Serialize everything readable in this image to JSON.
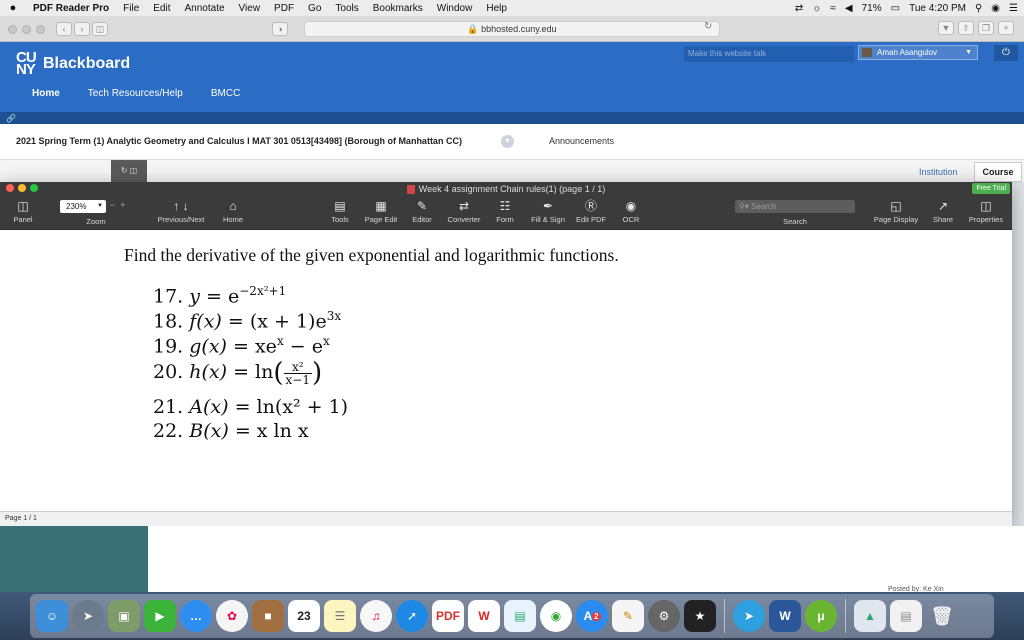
{
  "menubar": {
    "apple": "",
    "items": [
      "PDF Reader Pro",
      "File",
      "Edit",
      "Annotate",
      "View",
      "PDF",
      "Go",
      "Tools",
      "Bookmarks",
      "Window",
      "Help"
    ],
    "battery": "71%",
    "clock": "Tue 4:20 PM"
  },
  "browser": {
    "url": "bbhosted.cuny.edu"
  },
  "blackboard": {
    "logo_top": "CU",
    "logo_bottom": "NY",
    "brand": "Blackboard",
    "notice": "Make this website talk",
    "user": "Aman Asangulov",
    "tabs": [
      "Home",
      "Tech Resources/Help",
      "BMCC"
    ],
    "course_title": "2021 Spring Term (1) Analytic Geometry and Calculus I MAT 301 0513[43498] (Borough of Manhattan CC)",
    "announcements": "Announcements",
    "institution": "Institution",
    "course": "Course"
  },
  "pdf_reader": {
    "doc_title": "Week 4 assignment Chain rules(1) (page 1 / 1)",
    "free_trial": "Free Trial",
    "zoom": "230%",
    "search_placeholder": "Search",
    "toolbar": {
      "panel": "Panel",
      "zoom": "Zoom",
      "prevnext": "Previous/Next",
      "home": "Home",
      "tools": "Tools",
      "page_edit": "Page Edit",
      "editor": "Editor",
      "converter": "Converter",
      "form": "Form",
      "fill_sign": "Fill & Sign",
      "edit_pdf": "Edit PDF",
      "ocr": "OCR",
      "search": "Search",
      "page_display": "Page Display",
      "share": "Share",
      "properties": "Properties"
    },
    "status": "Page 1 / 1"
  },
  "document": {
    "instruction": "Find the derivative of the given exponential and logarithmic functions.",
    "problems": [
      {
        "num": "17.",
        "lhs": "y",
        "text": " = e",
        "exp": "−2x²+1"
      },
      {
        "num": "18.",
        "lhs": "f(x)",
        "text": " = (x + 1)e",
        "exp": "3x"
      },
      {
        "num": "19.",
        "lhs": "g(x)",
        "text": " = xe",
        "exp": "x",
        "tail": " − e",
        "tail_exp": "x"
      },
      {
        "num": "20.",
        "lhs": "h(x)",
        "text": " = ln",
        "frac_num": "x²",
        "frac_den": "x−1"
      },
      {
        "num": "21.",
        "lhs": "A(x)",
        "text": " = ln(x² + 1)"
      },
      {
        "num": "22.",
        "lhs": "B(x)",
        "text": " = x ln x"
      }
    ]
  },
  "background": {
    "posted_by": "Posted by: Ke Xin"
  },
  "dock": {
    "calendar_day": "23",
    "appstore_badge": "2"
  }
}
